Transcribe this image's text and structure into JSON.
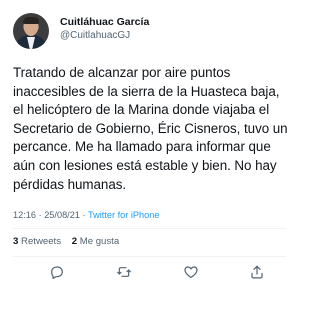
{
  "author": {
    "display_name": "Cuitláhuac García",
    "handle": "@CuitlahuacGJ"
  },
  "tweet": {
    "text": "Tratando de alcanzar por aire puntos inaccesibles de la sierra de la Huasteca baja, el helicóptero de la Marina donde viajaba el Secretario de Gobierno, Éric Cisneros, tuvo un percance. Me ha llamado para informar que aún con lesiones está estable y bien. No hay pérdidas humanas.",
    "time": "12:16",
    "date": "25/08/21",
    "separator": "·",
    "source": "Twitter for iPhone"
  },
  "stats": {
    "retweets_count": "3",
    "retweets_label": "Retweets",
    "likes_count": "2",
    "likes_label": "Me gusta"
  },
  "actions": {
    "icons": [
      "reply-icon",
      "retweet-icon",
      "like-icon",
      "share-icon"
    ]
  },
  "colors": {
    "text": "#0f1419",
    "secondary": "#536471",
    "link": "#1d9bf0",
    "divider": "#eff3f4"
  }
}
